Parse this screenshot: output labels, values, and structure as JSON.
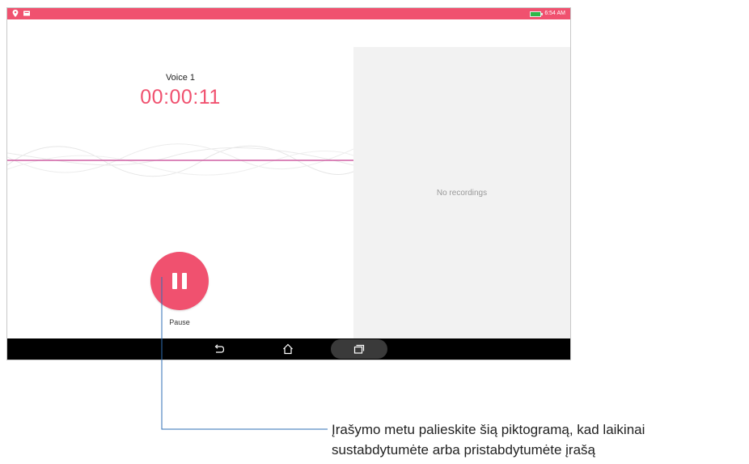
{
  "statusbar": {
    "left_icons": [
      "location-icon",
      "notification-icon"
    ],
    "battery": "battery-charging-icon",
    "time": "6:54 AM"
  },
  "recorder": {
    "title": "Voice 1",
    "timer": "00:00:11",
    "pause_icon": "pause-icon",
    "pause_label": "Pause"
  },
  "recordings": {
    "empty_text": "No recordings"
  },
  "navbar": {
    "back_icon": "back-icon",
    "home_icon": "home-icon",
    "recents_icon": "recents-icon"
  },
  "callout": {
    "line1": "Įrašymo metu palieskite šią piktogramą, kad laikinai",
    "line2": "sustabdytumėte arba pristabdytumėte įrašą"
  },
  "colors": {
    "accent": "#f0516f",
    "nav_bg": "#000000",
    "pane_bg": "#f2f2f2",
    "battery": "#2eb84a",
    "leader_line": "#2f6fb4"
  }
}
